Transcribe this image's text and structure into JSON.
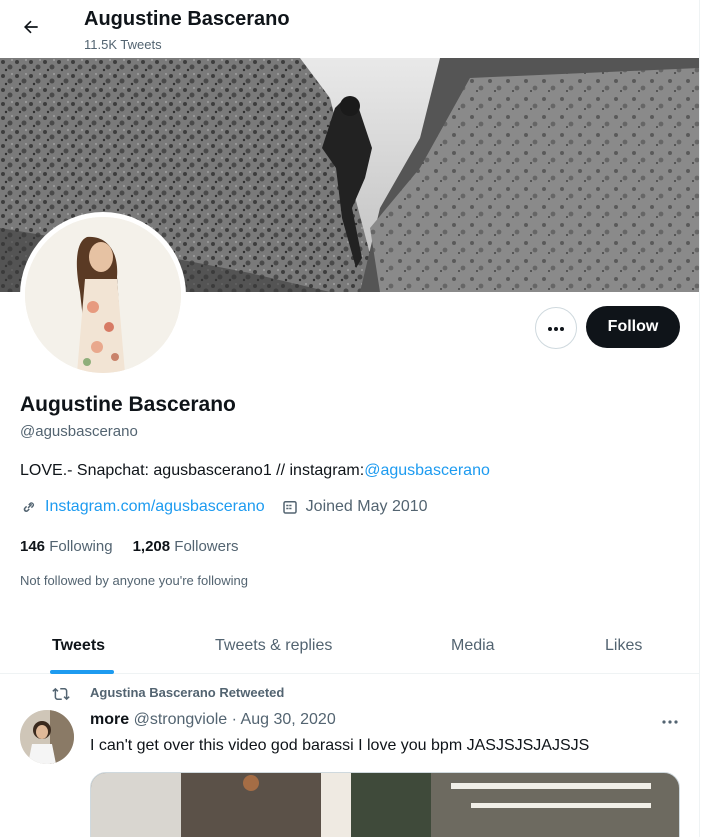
{
  "header": {
    "name": "Augustine Bascerano",
    "tweet_count": "11.5K Tweets"
  },
  "profile": {
    "name": "Augustine Bascerano",
    "handle": "@agusbascerano",
    "bio_text": "LOVE.- Snapchat: agusbascerano1 // instagram:",
    "bio_link": "@agusbascerano",
    "website": "Instagram.com/agusbascerano",
    "joined": "Joined May 2010",
    "following_count": "146",
    "following_label": "Following",
    "followers_count": "1,208",
    "followers_label": "Followers",
    "not_followed": "Not followed by anyone you're following",
    "follow_label": "Follow"
  },
  "tabs": [
    {
      "label": "Tweets",
      "active": true
    },
    {
      "label": "Tweets & replies",
      "active": false
    },
    {
      "label": "Media",
      "active": false
    },
    {
      "label": "Likes",
      "active": false
    }
  ],
  "tweet": {
    "retweet_label": "Agustina Bascerano Retweeted",
    "author": "more",
    "meta": "@strongviole · Aug 30, 2020",
    "text": "I can't get over this video god barassi I love you bpm JASJSJSJAJSJS"
  },
  "colors": {
    "accent": "#1d9bf0",
    "text": "#0f1419",
    "muted": "#536471",
    "follow_bg": "#0f1419"
  },
  "icons": [
    "back-arrow-icon",
    "more-icon",
    "link-icon",
    "calendar-icon",
    "retweet-icon"
  ]
}
